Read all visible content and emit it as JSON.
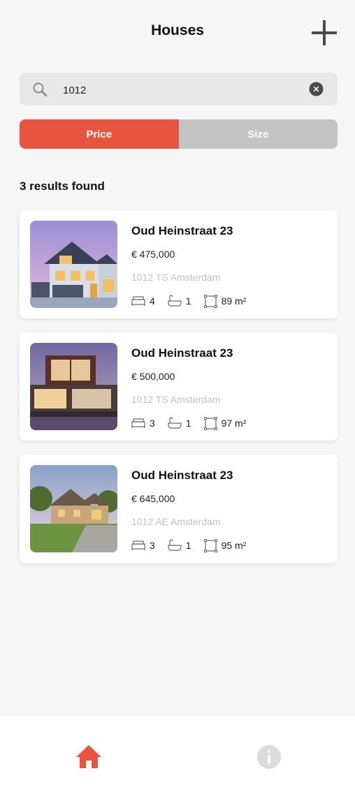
{
  "header": {
    "title": "Houses",
    "add_icon": "plus-icon"
  },
  "search": {
    "value": "1012",
    "icon": "search-icon",
    "clear_icon": "clear-icon"
  },
  "sort": {
    "options": [
      "Price",
      "Size"
    ],
    "selected": "Price"
  },
  "results": {
    "label": "3 results found"
  },
  "listings": [
    {
      "address": "Oud Heinstraat 23",
      "price": "€ 475,000",
      "zip_city": "1012 TS Amsterdam",
      "bedrooms": "4",
      "bathrooms": "1",
      "size": "89 m²"
    },
    {
      "address": "Oud Heinstraat 23",
      "price": "€ 500,000",
      "zip_city": "1012 TS Amsterdam",
      "bedrooms": "3",
      "bathrooms": "1",
      "size": "97 m²"
    },
    {
      "address": "Oud Heinstraat 23",
      "price": "€ 645,000",
      "zip_city": "1012 AE Amsterdam",
      "bedrooms": "3",
      "bathrooms": "1",
      "size": "95 m²"
    }
  ],
  "nav": {
    "items": [
      {
        "icon": "home-icon",
        "active": true
      },
      {
        "icon": "info-icon",
        "active": false
      }
    ]
  },
  "colors": {
    "accent": "#e95440",
    "inactive": "#c4c4c4",
    "background": "#f6f6f6",
    "muted_text": "#c2c2c2"
  }
}
